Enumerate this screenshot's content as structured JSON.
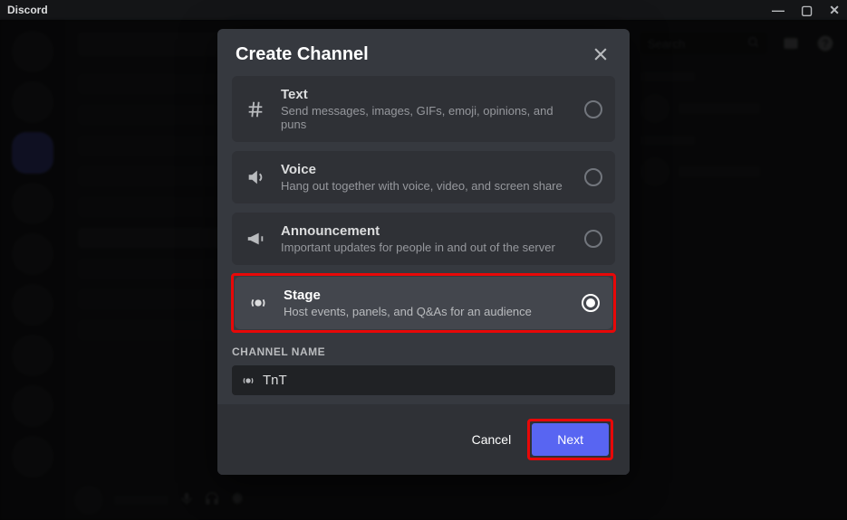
{
  "app_name": "Discord",
  "search_placeholder": "Search",
  "modal": {
    "title": "Create Channel",
    "types": [
      {
        "key": "text",
        "title": "Text",
        "desc": "Send messages, images, GIFs, emoji, opinions, and puns",
        "selected": false
      },
      {
        "key": "voice",
        "title": "Voice",
        "desc": "Hang out together with voice, video, and screen share",
        "selected": false
      },
      {
        "key": "announcement",
        "title": "Announcement",
        "desc": "Important updates for people in and out of the server",
        "selected": false
      },
      {
        "key": "stage",
        "title": "Stage",
        "desc": "Host events, panels, and Q&As for an audience",
        "selected": true
      }
    ],
    "channel_name_label": "CHANNEL NAME",
    "channel_name_value": "TnT",
    "footer": {
      "cancel": "Cancel",
      "next": "Next"
    }
  }
}
